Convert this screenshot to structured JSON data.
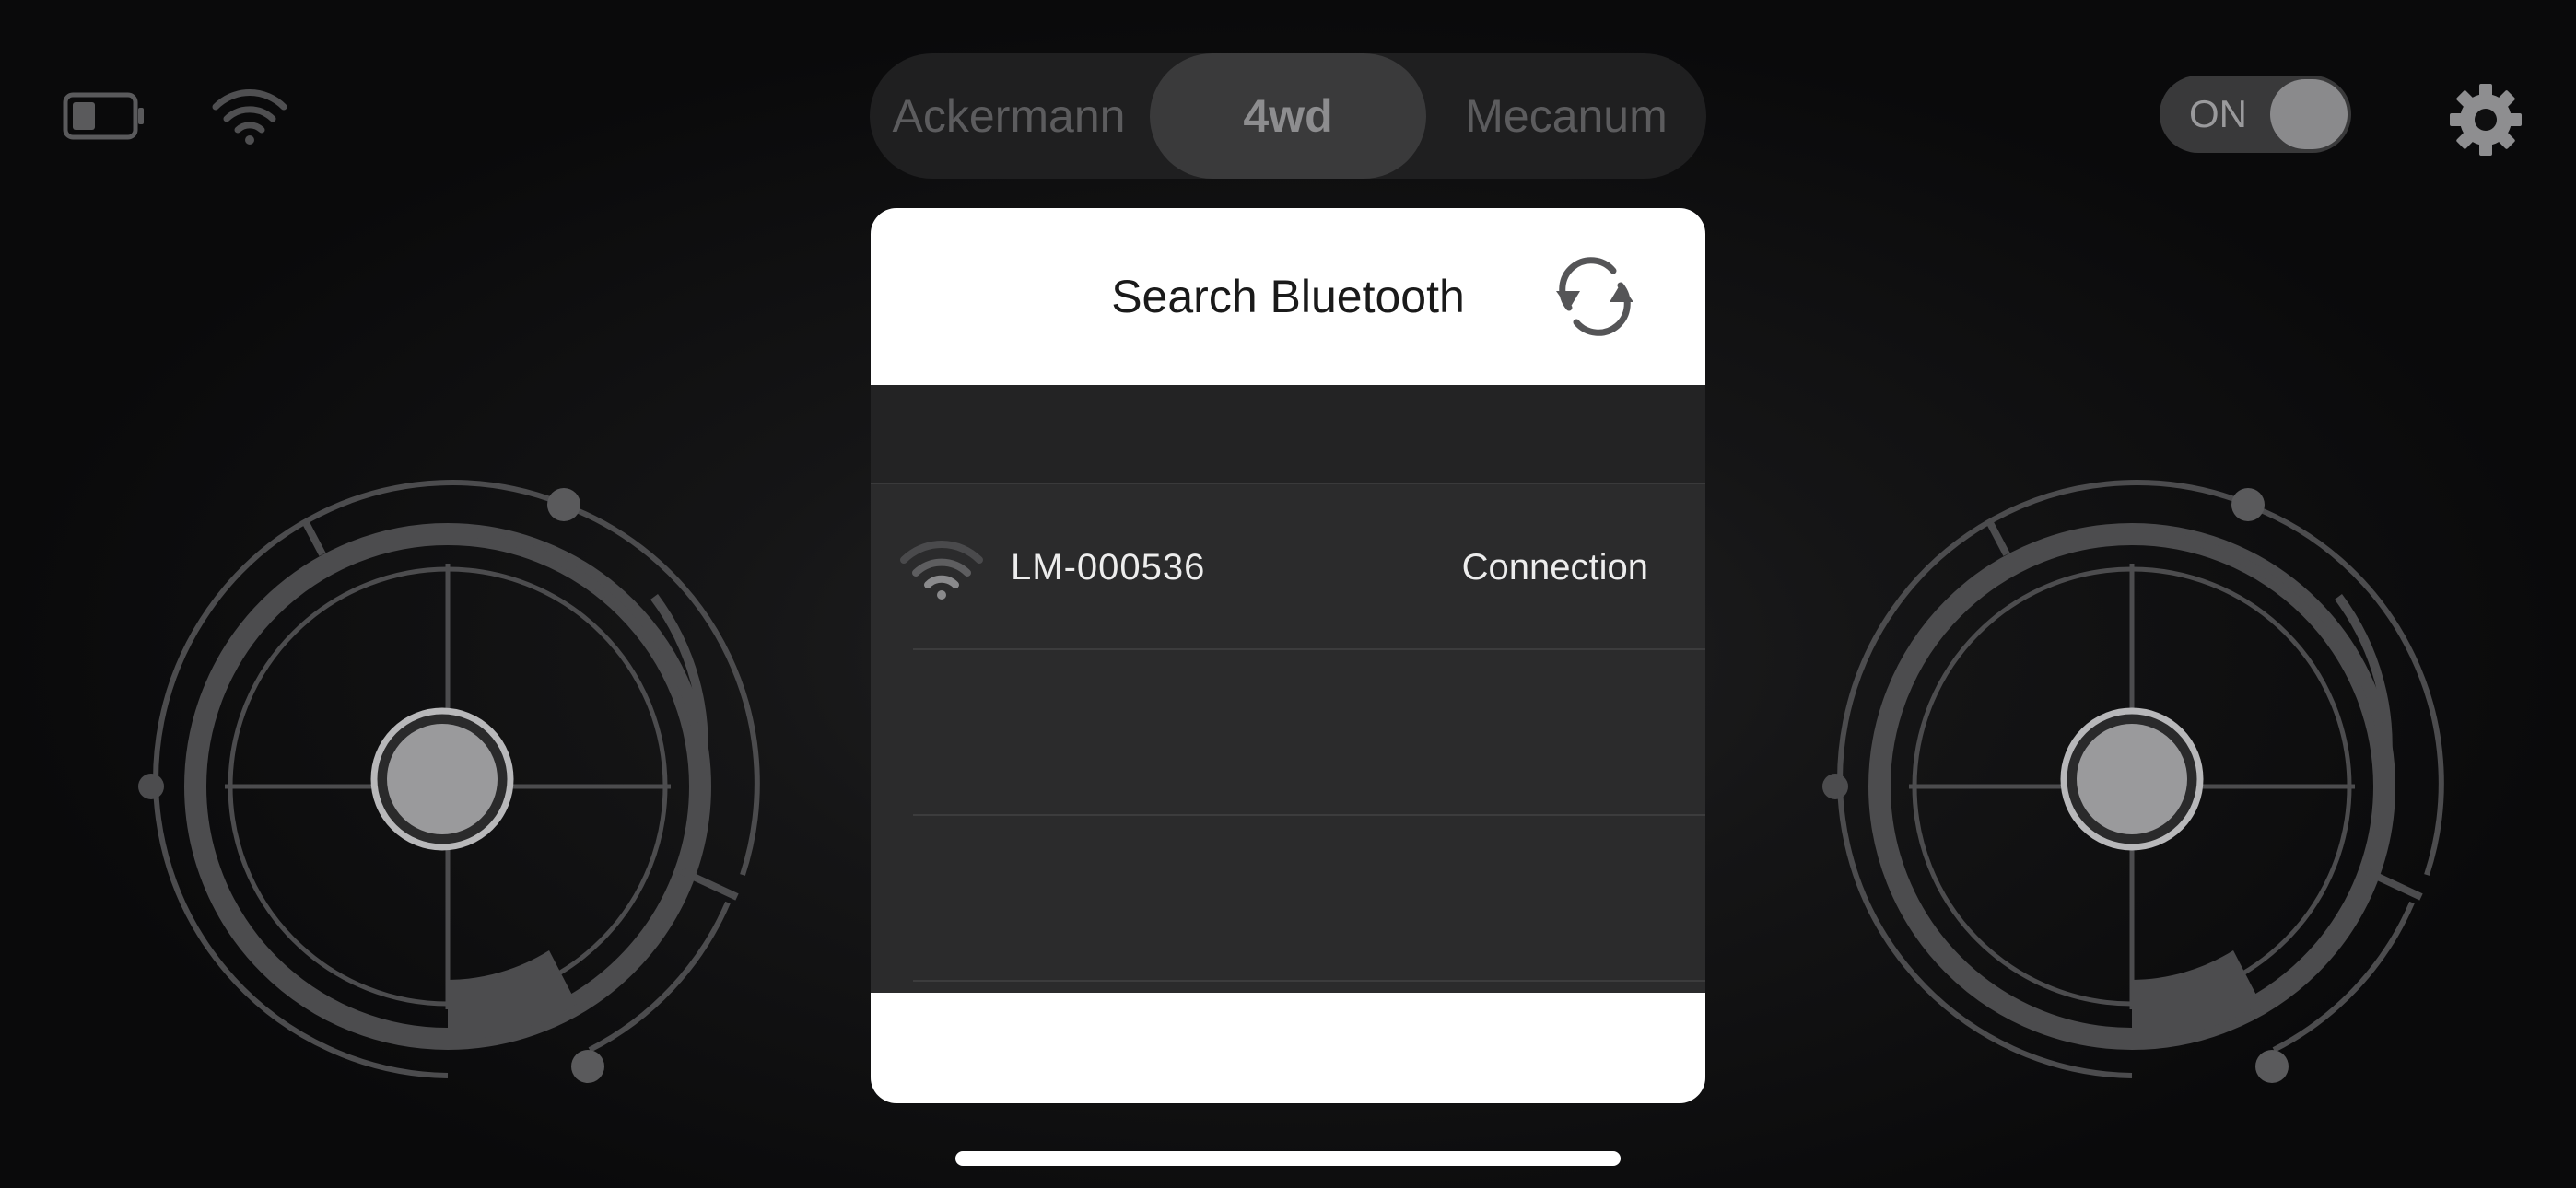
{
  "status": {
    "battery_icon": "battery-low-icon",
    "wifi_icon": "wifi-icon"
  },
  "drive_modes": {
    "tabs": [
      "Ackermann",
      "4wd",
      "Mecanum"
    ],
    "selected": "4wd"
  },
  "power": {
    "label": "ON",
    "state": "on"
  },
  "settings_icon": "gear-icon",
  "bluetooth_modal": {
    "title": "Search Bluetooth",
    "refresh_icon": "refresh-icon",
    "devices": [
      {
        "name": "LM-000536",
        "action": "Connection",
        "icon": "wifi-signal-icon"
      }
    ]
  },
  "colors": {
    "background": "#0b0b0c",
    "modal_header": "#ffffff",
    "modal_body": "#2b2b2c",
    "joystick": "#5a5a5c",
    "joystick_knob": "#9a9a9c"
  }
}
